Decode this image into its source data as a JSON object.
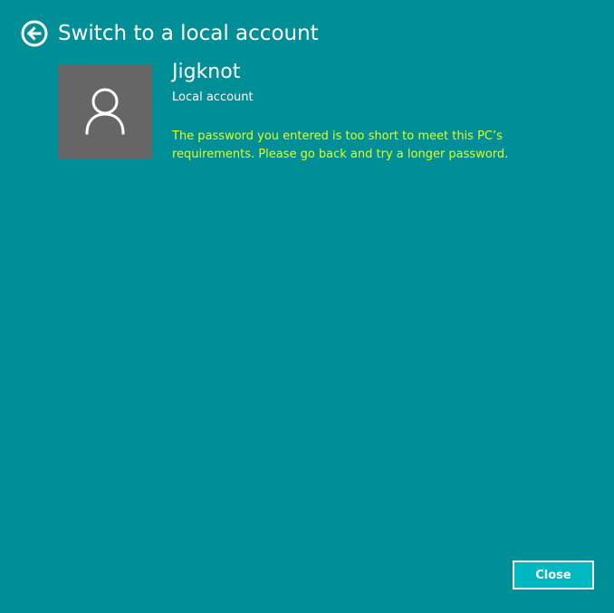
{
  "window": {
    "title": "Switch to a local account",
    "background_color": "#008f96"
  },
  "header": {
    "back_icon": "back-arrow-circle-icon",
    "title": "Switch to a local account"
  },
  "account": {
    "avatar_icon": "user-icon",
    "name": "Jigknot",
    "type": "Local account",
    "avatar_color": "#666666"
  },
  "error": {
    "message": "The password you entered is too short to meet this PC’s requirements. Please go back and try a longer password.",
    "color": "#e6ff0f"
  },
  "footer": {
    "close_label": "Close",
    "button_color": "#00b8c1"
  }
}
